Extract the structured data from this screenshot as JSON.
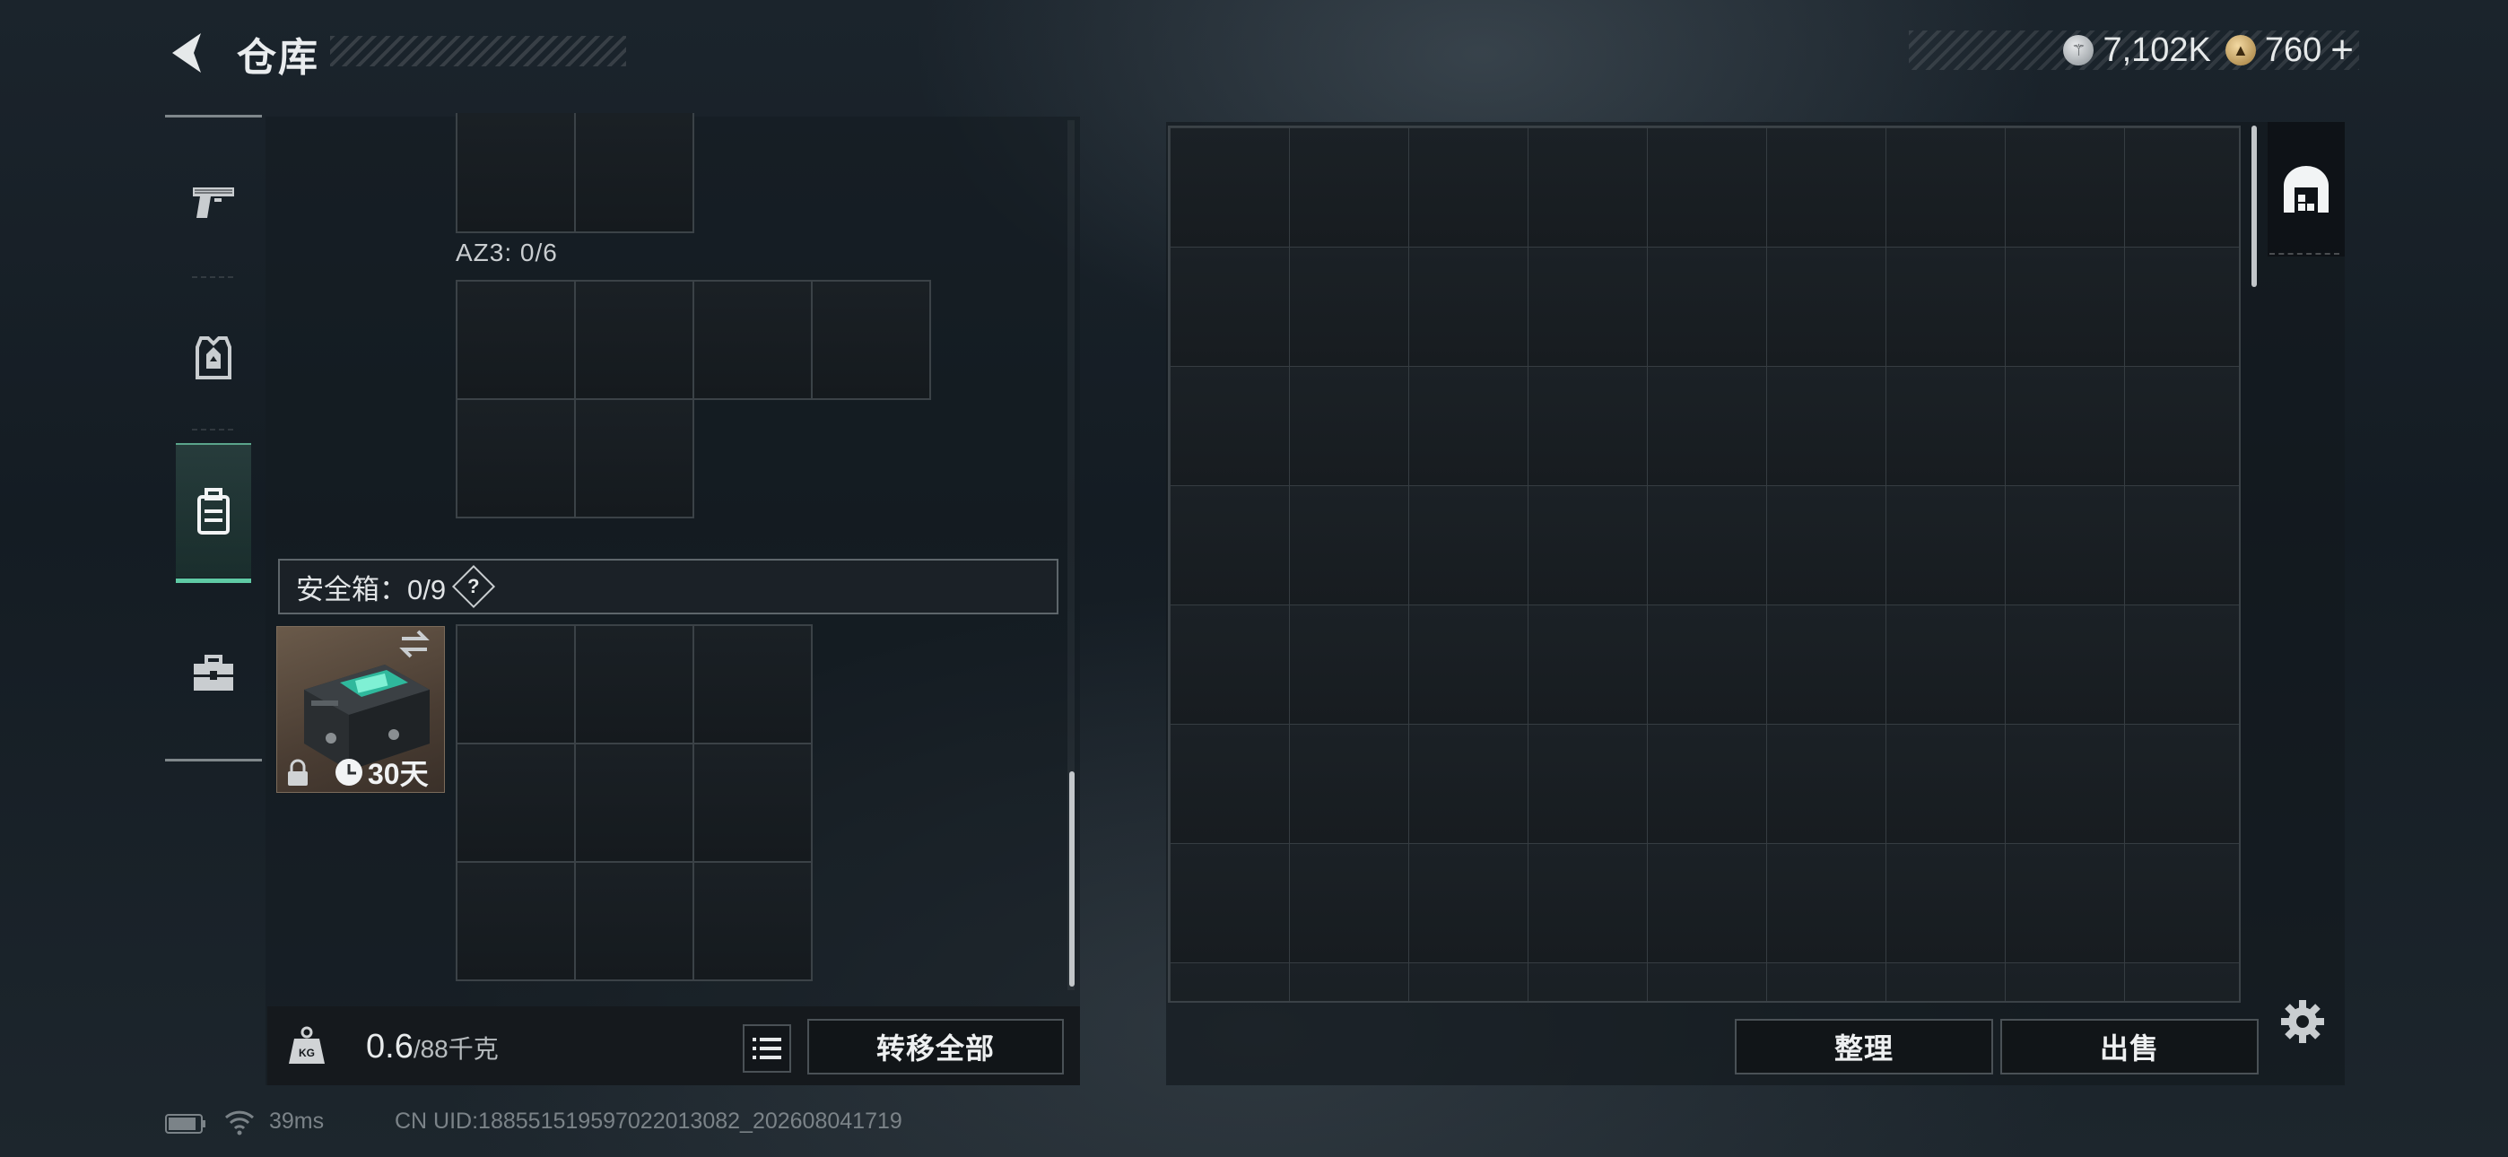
{
  "header": {
    "title": "仓库",
    "currencies": [
      {
        "name": "silver-coin",
        "value": "7,102K"
      },
      {
        "name": "gold-coin",
        "value": "760"
      }
    ],
    "add_symbol": "+"
  },
  "sidebar": {
    "items": [
      {
        "name": "weapons",
        "icon": "pistol-icon",
        "active": false
      },
      {
        "name": "armor",
        "icon": "vest-icon",
        "active": false
      },
      {
        "name": "backpack",
        "icon": "backpack-icon",
        "active": true
      },
      {
        "name": "medkit",
        "icon": "toolbox-icon",
        "active": false
      }
    ]
  },
  "left_panel": {
    "az3_label": "AZ3: 0/6",
    "safebox": {
      "label": "安全箱：0/9",
      "help": "?",
      "item_days": "30天"
    },
    "weight": {
      "current": "0.6",
      "max": "/88千克"
    },
    "transfer_all": "转移全部"
  },
  "right_panel": {
    "sort_button": "整理",
    "sell_button": "出售"
  },
  "footer": {
    "ping": "39ms",
    "uid": "CN UID:188551519597022013082_202608041719"
  },
  "colors": {
    "accent": "#5fcba5",
    "panel": "#151a1e",
    "cell_border": "#3b4247"
  }
}
